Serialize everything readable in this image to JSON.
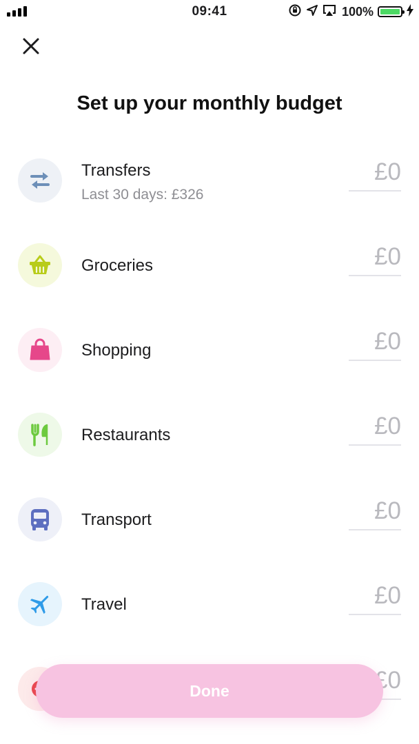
{
  "status_bar": {
    "time": "09:41",
    "battery_percent": "100%",
    "battery_level": 1.0,
    "battery_color": "#4cd964"
  },
  "header": {
    "close_icon": "close-icon",
    "title": "Set up your monthly budget"
  },
  "categories": [
    {
      "name": "Transfers",
      "subtitle": "Last 30 days: £326",
      "amount_placeholder": "£0",
      "icon": "transfer-arrows-icon",
      "icon_color": "#6d8fb8",
      "bg_color": "#eef1f6"
    },
    {
      "name": "Groceries",
      "amount_placeholder": "£0",
      "icon": "basket-icon",
      "icon_color": "#b8cc1a",
      "bg_color": "#f5f9dc"
    },
    {
      "name": "Shopping",
      "amount_placeholder": "£0",
      "icon": "shopping-bag-icon",
      "icon_color": "#e6478a",
      "bg_color": "#fdeef4"
    },
    {
      "name": "Restaurants",
      "amount_placeholder": "£0",
      "icon": "cutlery-icon",
      "icon_color": "#6dca3f",
      "bg_color": "#eef9e8"
    },
    {
      "name": "Transport",
      "amount_placeholder": "£0",
      "icon": "bus-icon",
      "icon_color": "#5d6fc0",
      "bg_color": "#eef0f8"
    },
    {
      "name": "Travel",
      "amount_placeholder": "£0",
      "icon": "airplane-icon",
      "icon_color": "#2f9be8",
      "bg_color": "#e6f4fd"
    },
    {
      "name": "",
      "amount_placeholder": "£0",
      "icon": "add-circle-icon",
      "icon_color": "#e8434a",
      "bg_color": "#fdeaea"
    }
  ],
  "footer": {
    "done_label": "Done",
    "accent_color": "#f7c3e1"
  }
}
